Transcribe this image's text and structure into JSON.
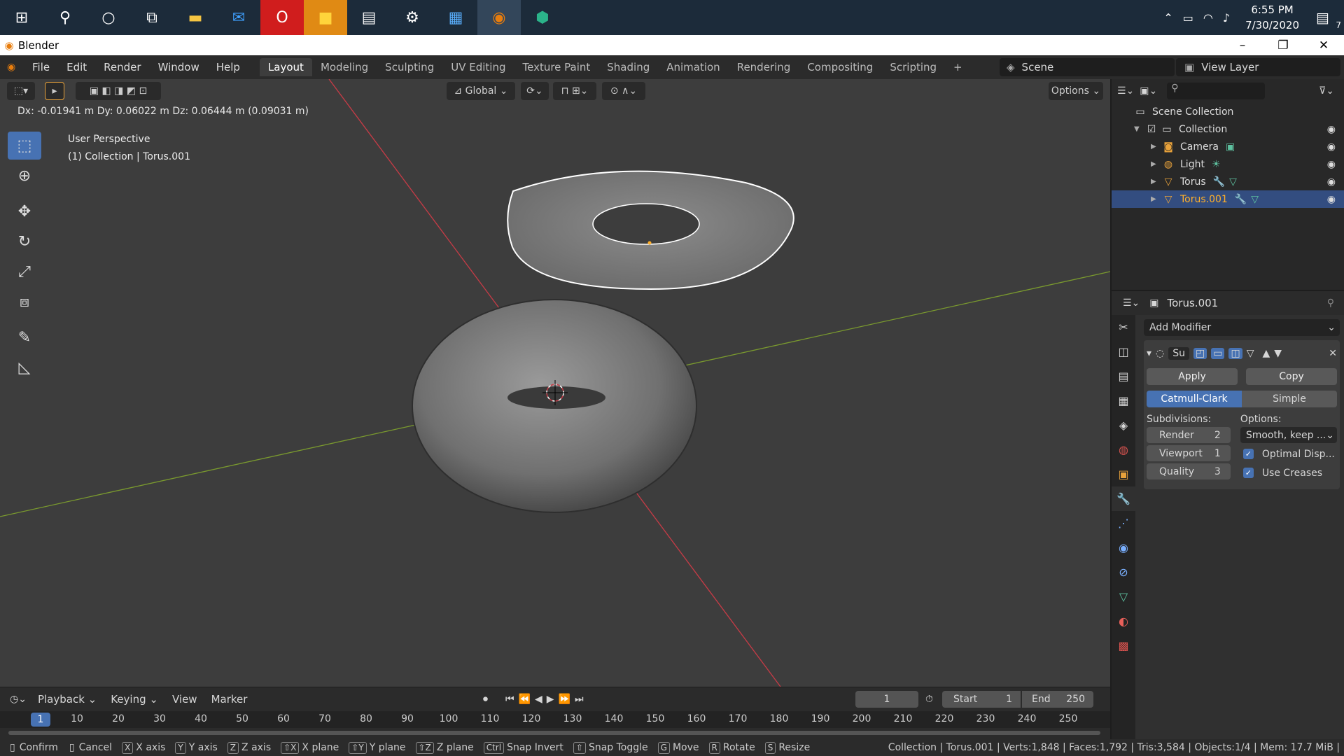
{
  "taskbar": {
    "icons": [
      "windows-icon",
      "search-icon",
      "cortana-icon",
      "task-view-icon",
      "file-explorer-icon",
      "mail-icon",
      "opera-icon",
      "sticky-notes-icon",
      "paint-icon",
      "settings-icon",
      "news-icon",
      "blender-icon",
      "app-icon"
    ],
    "time": "6:55 PM",
    "date": "7/30/2020",
    "notifications": "7"
  },
  "titlebar": {
    "title": "Blender"
  },
  "menu": {
    "items": [
      "File",
      "Edit",
      "Render",
      "Window",
      "Help"
    ],
    "workspaces": [
      "Layout",
      "Modeling",
      "Sculpting",
      "UV Editing",
      "Texture Paint",
      "Shading",
      "Animation",
      "Rendering",
      "Compositing",
      "Scripting"
    ],
    "add_tab": "+",
    "scene": "Scene",
    "view_layer": "View Layer"
  },
  "viewport": {
    "orientation": "Global",
    "options": "Options",
    "readout": "Dx: -0.01941 m   Dy: 0.06022 m   Dz: 0.06444 m (0.09031 m)",
    "perspective": "User Perspective",
    "context": "(1) Collection | Torus.001"
  },
  "outliner": {
    "root": "Scene Collection",
    "collection": "Collection",
    "items": [
      "Camera",
      "Light",
      "Torus",
      "Torus.001"
    ]
  },
  "properties": {
    "object_name": "Torus.001",
    "add_modifier": "Add Modifier",
    "modifier_name": "Su",
    "apply": "Apply",
    "copy": "Copy",
    "catmull": "Catmull-Clark",
    "simple": "Simple",
    "subdivisions_label": "Subdivisions:",
    "options_label": "Options:",
    "render_label": "Render",
    "render_value": "2",
    "viewport_label": "Viewport",
    "viewport_value": "1",
    "quality_label": "Quality",
    "quality_value": "3",
    "uv_smooth": "Smooth, keep ...",
    "optimal_display": "Optimal Disp...",
    "use_creases": "Use Creases"
  },
  "timeline": {
    "menus": [
      "Playback",
      "Keying",
      "View",
      "Marker"
    ],
    "current_frame": "1",
    "start_label": "Start",
    "start_value": "1",
    "end_label": "End",
    "end_value": "250",
    "ruler": [
      "10",
      "20",
      "30",
      "40",
      "50",
      "60",
      "70",
      "80",
      "90",
      "100",
      "110",
      "120",
      "130",
      "140",
      "150",
      "160",
      "170",
      "180",
      "190",
      "200",
      "210",
      "220",
      "230",
      "240",
      "250"
    ]
  },
  "statusbar": {
    "hints": [
      {
        "key": "",
        "label": "Confirm"
      },
      {
        "key": "",
        "label": "Cancel"
      },
      {
        "key": "X",
        "label": "X axis"
      },
      {
        "key": "Y",
        "label": "Y axis"
      },
      {
        "key": "Z",
        "label": "Z axis"
      },
      {
        "key": "⇧X",
        "label": "X plane"
      },
      {
        "key": "⇧Y",
        "label": "Y plane"
      },
      {
        "key": "⇧Z",
        "label": "Z plane"
      },
      {
        "key": "Ctrl",
        "label": "Snap Invert"
      },
      {
        "key": "⇧",
        "label": "Snap Toggle"
      },
      {
        "key": "G",
        "label": "Move"
      },
      {
        "key": "R",
        "label": "Rotate"
      },
      {
        "key": "S",
        "label": "Resize"
      }
    ],
    "stats": "Collection | Torus.001 | Verts:1,848 | Faces:1,792 | Tris:3,584 | Objects:1/4 | Mem: 17.7 MiB |"
  },
  "colors": {
    "accent": "#4772b3",
    "selected_text": "#ffaf29",
    "x_axis": "#c73b46",
    "y_axis": "#7a9a2e"
  }
}
